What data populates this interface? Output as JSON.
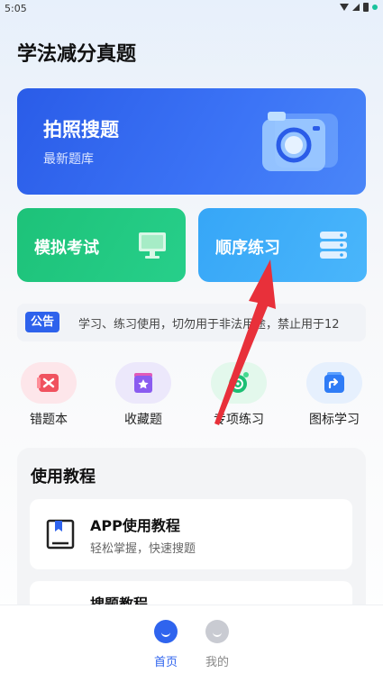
{
  "status_bar": {
    "time": "5:05"
  },
  "app": {
    "title": "学法减分真题"
  },
  "photo_card": {
    "title": "拍照搜题",
    "subtitle": "最新题库"
  },
  "quick_cards": {
    "mock": {
      "label": "模拟考试"
    },
    "sequence": {
      "label": "顺序练习"
    }
  },
  "notice": {
    "badge": "公告",
    "text": "学习、练习使用，切勿用于非法用途，禁止用于12"
  },
  "features": [
    {
      "label": "错题本",
      "icon": "wrong-book-icon"
    },
    {
      "label": "收藏题",
      "icon": "favorite-icon"
    },
    {
      "label": "专项练习",
      "icon": "special-practice-icon"
    },
    {
      "label": "图标学习",
      "icon": "icon-study-icon"
    }
  ],
  "tutorial": {
    "heading": "使用教程",
    "items": [
      {
        "title": "APP使用教程",
        "subtitle": "轻松掌握，快速搜题"
      },
      {
        "title": "搜题教程",
        "subtitle": ""
      }
    ]
  },
  "bottom_nav": {
    "items": [
      {
        "label": "首页",
        "active": true
      },
      {
        "label": "我的",
        "active": false
      }
    ]
  },
  "colors": {
    "primary": "#2f64ee",
    "mock_green": "#1dc279",
    "sequence_blue": "#36a6f7",
    "annotation_red": "#e8303a"
  }
}
